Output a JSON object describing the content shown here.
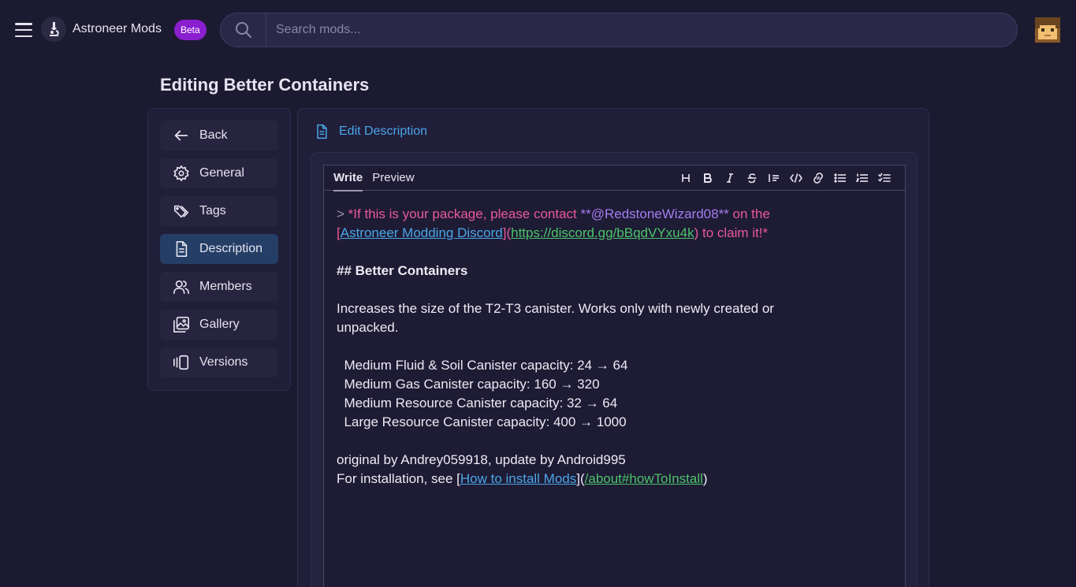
{
  "header": {
    "app_title": "Astroneer Mods",
    "beta_label": "Beta",
    "search_placeholder": "Search mods..."
  },
  "page": {
    "title": "Editing Better Containers"
  },
  "sidebar": {
    "items": [
      {
        "label": "Back",
        "icon": "arrow-left-icon"
      },
      {
        "label": "General",
        "icon": "gear-icon"
      },
      {
        "label": "Tags",
        "icon": "tags-icon"
      },
      {
        "label": "Description",
        "icon": "document-icon",
        "active": true
      },
      {
        "label": "Members",
        "icon": "users-icon"
      },
      {
        "label": "Gallery",
        "icon": "gallery-icon"
      },
      {
        "label": "Versions",
        "icon": "versions-icon"
      }
    ]
  },
  "panel": {
    "heading": "Edit Description",
    "tabs": [
      "Write",
      "Preview"
    ],
    "toolbar": [
      "H",
      "B",
      "I",
      "S"
    ]
  },
  "editor": {
    "line1": {
      "quote": ">",
      "part1": " *If this is your package, please contact ",
      "mention": "**@RedstoneWizard08**",
      "part2": " on the"
    },
    "line2": {
      "bracket_open": "[",
      "link_text": "Astroneer Modding Discord",
      "bracket_mid": "](",
      "url": "https://discord.gg/bBqdVYxu4k",
      "tail": ") to claim it!*"
    },
    "heading": "## Better Containers",
    "para1a": "Increases the size of the T2-T3 canister. Works only with newly created or",
    "para1b": "unpacked.",
    "list": [
      "  Medium Fluid & Soil Canister capacity: 24 → 64",
      "  Medium Gas Canister capacity: 160 → 320",
      "  Medium Resource Canister capacity: 32 → 64",
      "  Large Resource Canister capacity: 400 → 1000"
    ],
    "credits": "original by Andrey059918, update by Android995",
    "install": {
      "prefix": "For installation, see [",
      "link_text": "How to install Mods",
      "mid": "](",
      "url": "/about#howToInstall",
      "tail": ")"
    }
  }
}
